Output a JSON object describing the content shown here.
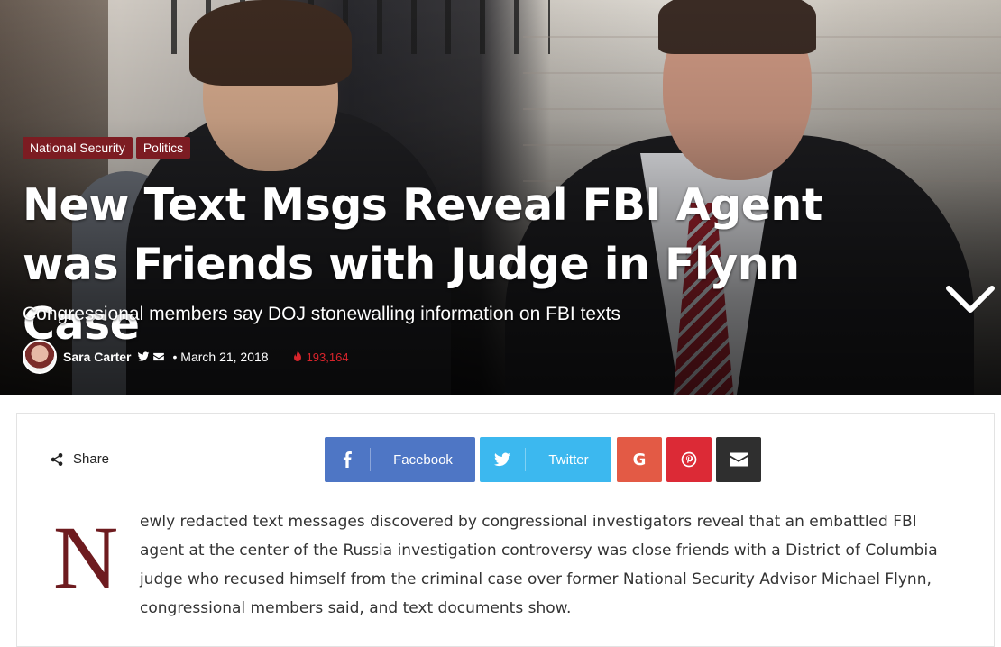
{
  "hero": {
    "categories": [
      "National Security",
      "Politics"
    ],
    "headline": "New Text Msgs Reveal FBI Agent was Friends with Judge in Flynn Case",
    "subhead": "Congressional members say DOJ stonewalling information on FBI texts",
    "author": "Sara Carter",
    "date": "• March 21, 2018",
    "views": "193,164",
    "icons": [
      "twitter-icon",
      "envelope-icon",
      "flame-icon",
      "chevron-down-icon"
    ]
  },
  "share": {
    "label": "Share",
    "facebook_label": "Facebook",
    "twitter_label": "Twitter",
    "google_label": "G"
  },
  "article": {
    "dropcap": "N",
    "first_paragraph": "ewly redacted text messages discovered by congressional investigators reveal that an embattled FBI agent at the center of the Russia investigation controversy was close friends with a District of Columbia judge who recused himself from the criminal case over former National Security Advisor Michael Flynn, congressional members said, and text documents show."
  },
  "colors": {
    "category_bg": "#7c1c22",
    "facebook": "#4e76c5",
    "twitter": "#3cb8ef",
    "google": "#e35a45",
    "pinterest": "#dc2a36",
    "email": "#2f2f2f",
    "views": "#d7242b",
    "dropcap": "#6e1b1f"
  }
}
